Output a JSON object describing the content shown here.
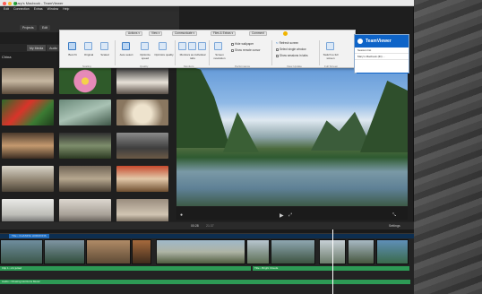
{
  "window": {
    "title": "Mary's Macbook - TeamViewer"
  },
  "app_menu": [
    "Edit",
    "Connection",
    "Extras",
    "Window",
    "Help"
  ],
  "editor_tabs": [
    "My Media",
    "Audio"
  ],
  "editor_buttons": [
    "Projects",
    "Edit"
  ],
  "media_breadcrumb": "China",
  "teamviewer_toolbar": {
    "top_menu": [
      "Actions",
      "View",
      "Communicate",
      "Files & Extras",
      "Comment"
    ],
    "groups": {
      "scaling": {
        "label": "Scaling",
        "items": [
          "Best fit",
          "Original",
          "Scaled"
        ]
      },
      "quality": {
        "label": "Quality",
        "items": [
          "Auto select",
          "Optimize speed",
          "Optimize quality"
        ]
      },
      "monitors": {
        "label": "Monitors",
        "items": [
          "Monitors as individual tabs"
        ]
      },
      "performance_btn": "Screen resolution",
      "performance": {
        "label": "Performance",
        "checks": [
          "Hide wallpaper",
          "Show remote cursor"
        ]
      },
      "view_update": {
        "label": "View Update",
        "checks": [
          "Refresh screen",
          "Select single window",
          "Show sessions in tabs"
        ]
      },
      "fullscreen": {
        "label": "Full Screen",
        "items": [
          "Switch to full screen"
        ]
      }
    }
  },
  "teamviewer_panel": {
    "brand": "TeamViewer",
    "session_list_label": "Session list",
    "session_row": "Mary's Macbook (ID) ..."
  },
  "player": {
    "time_left": "00:28",
    "time_right": "21:37",
    "settings": "Settings"
  },
  "timeline": {
    "title_clip": "Title • CHASING HORIZONS",
    "video_track_label": "Clip 1 • A1 jutted",
    "audio_label_a": "Title • Bright Clouds",
    "audio_label_b": "Audio • Chasing Horizons Music"
  },
  "colors": {
    "teamviewer_blue": "#0e64c8",
    "audio_green": "#2d9a55",
    "title_track_blue": "#1e6bbd"
  }
}
